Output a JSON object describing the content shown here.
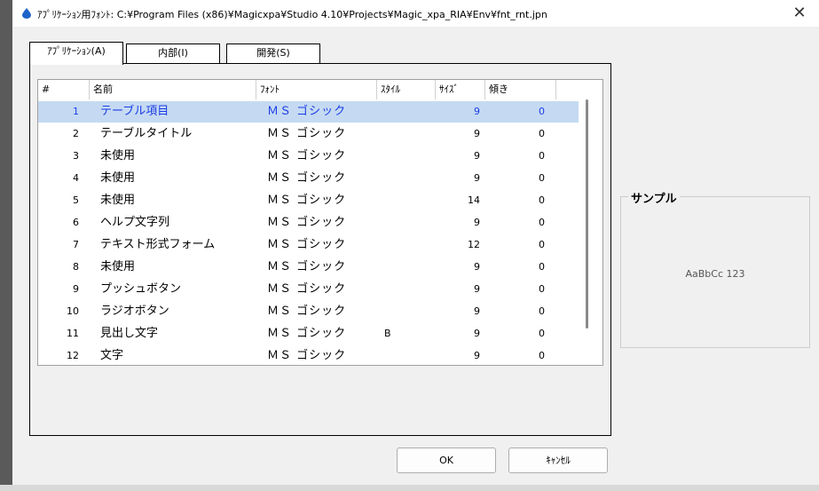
{
  "window": {
    "title": "ｱﾌﾟﾘｹｰｼｮﾝ用ﾌｫﾝﾄ: C:¥Program Files (x86)¥Magicxpa¥Studio 4.10¥Projects¥Magic_xpa_RIA¥Env¥fnt_rnt.jpn",
    "close_label": "✕",
    "icon": "app-drop-icon",
    "accent_color": "#1e64c8"
  },
  "tabs": [
    {
      "label": "ｱﾌﾟﾘｹｰｼｮﾝ(A)",
      "active": true
    },
    {
      "label": "内部(I)",
      "active": false
    },
    {
      "label": "開発(S)",
      "active": false
    }
  ],
  "table": {
    "headers": {
      "num": "#",
      "name": "名前",
      "font": "ﾌｫﾝﾄ",
      "style": "ｽﾀｲﾙ",
      "size": "ｻｲｽﾞ",
      "slant": "傾き"
    },
    "rows": [
      {
        "num": "1",
        "name": "テーブル項目",
        "font": "ＭＳ ゴシック",
        "style": "",
        "size": "9",
        "slant": "0",
        "selected": true
      },
      {
        "num": "2",
        "name": "テーブルタイトル",
        "font": "ＭＳ ゴシック",
        "style": "",
        "size": "9",
        "slant": "0"
      },
      {
        "num": "3",
        "name": "未使用",
        "font": "ＭＳ ゴシック",
        "style": "",
        "size": "9",
        "slant": "0"
      },
      {
        "num": "4",
        "name": "未使用",
        "font": "ＭＳ ゴシック",
        "style": "",
        "size": "9",
        "slant": "0"
      },
      {
        "num": "5",
        "name": "未使用",
        "font": "ＭＳ ゴシック",
        "style": "",
        "size": "14",
        "slant": "0"
      },
      {
        "num": "6",
        "name": "ヘルプ文字列",
        "font": "ＭＳ ゴシック",
        "style": "",
        "size": "9",
        "slant": "0"
      },
      {
        "num": "7",
        "name": "テキスト形式フォーム",
        "font": "ＭＳ ゴシック",
        "style": "",
        "size": "12",
        "slant": "0"
      },
      {
        "num": "8",
        "name": "未使用",
        "font": "ＭＳ ゴシック",
        "style": "",
        "size": "9",
        "slant": "0"
      },
      {
        "num": "9",
        "name": "プッシュボタン",
        "font": "ＭＳ ゴシック",
        "style": "",
        "size": "9",
        "slant": "0"
      },
      {
        "num": "10",
        "name": "ラジオボタン",
        "font": "ＭＳ ゴシック",
        "style": "",
        "size": "9",
        "slant": "0"
      },
      {
        "num": "11",
        "name": "見出し文字",
        "font": "ＭＳ ゴシック",
        "style": "B",
        "size": "9",
        "slant": "0"
      },
      {
        "num": "12",
        "name": "文字",
        "font": "ＭＳ ゴシック",
        "style": "",
        "size": "9",
        "slant": "0"
      }
    ]
  },
  "sample": {
    "label": "サンプル",
    "text": "AaBbCc 123"
  },
  "buttons": {
    "ok": "OK",
    "cancel": "ｷｬﾝｾﾙ"
  }
}
